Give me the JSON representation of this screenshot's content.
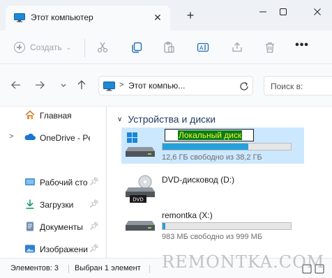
{
  "window": {
    "tab_title": "Этот компьютер",
    "tab_close_glyph": "✕",
    "new_tab_glyph": "+",
    "icons": [
      "this-pc-icon",
      "close-icon",
      "add-tab-icon",
      "minimize-icon",
      "maximize-icon",
      "window-close-icon"
    ]
  },
  "commandbar": {
    "create_label": "Создать",
    "more_glyph": "•••",
    "icons": [
      "plus-circle-icon",
      "chevron-down-icon",
      "cut-icon",
      "copy-icon",
      "paste-icon",
      "rename-icon",
      "share-icon",
      "delete-icon",
      "more-icon"
    ]
  },
  "address": {
    "location": "Этот компью...",
    "search_placeholder": "Поиск в:",
    "icons": [
      "back-icon",
      "forward-icon",
      "up-icon",
      "this-pc-icon",
      "chevron-right-icon",
      "refresh-icon"
    ]
  },
  "sidebar": {
    "items": [
      {
        "label": "Главная",
        "icon": "home-icon",
        "expandable": false,
        "pinned": false
      },
      {
        "label": "OneDrive - Pers",
        "icon": "onedrive-icon",
        "expandable": true,
        "pinned": false
      },
      {
        "label": "Рабочий сто",
        "icon": "desktop-icon",
        "expandable": false,
        "pinned": true
      },
      {
        "label": "Загрузки",
        "icon": "downloads-icon",
        "expandable": false,
        "pinned": true
      },
      {
        "label": "Документы",
        "icon": "documents-icon",
        "expandable": false,
        "pinned": true
      },
      {
        "label": "Изображени",
        "icon": "pictures-icon",
        "expandable": false,
        "pinned": true
      }
    ]
  },
  "main": {
    "group_title": "Устройства и диски",
    "drives": [
      {
        "name": "Локальный диск",
        "size_text": "12,6 ГБ свободно из 38,2 ГБ",
        "used_fraction": 0.67,
        "selected": true,
        "renaming": true,
        "icon": "windows-drive-icon"
      },
      {
        "name": "DVD-дисковод (D:)",
        "size_text": "",
        "used_fraction": null,
        "selected": false,
        "renaming": false,
        "icon": "dvd-drive-icon",
        "badge": "DVD"
      },
      {
        "name": "remontka (X:)",
        "size_text": "983 МБ свободно из 999 МБ",
        "used_fraction": 0.02,
        "selected": false,
        "renaming": false,
        "icon": "drive-icon"
      }
    ]
  },
  "status": {
    "count": "Элементов: 3",
    "selected": "Выбран 1 элемент"
  },
  "watermark": "REMONTKA.COM",
  "colors": {
    "accent": "#0067c0",
    "selection": "#cce8ff",
    "progress": "#26a0da",
    "rename_bg": "#0b7d1a",
    "rename_text": "#f7f32a"
  }
}
